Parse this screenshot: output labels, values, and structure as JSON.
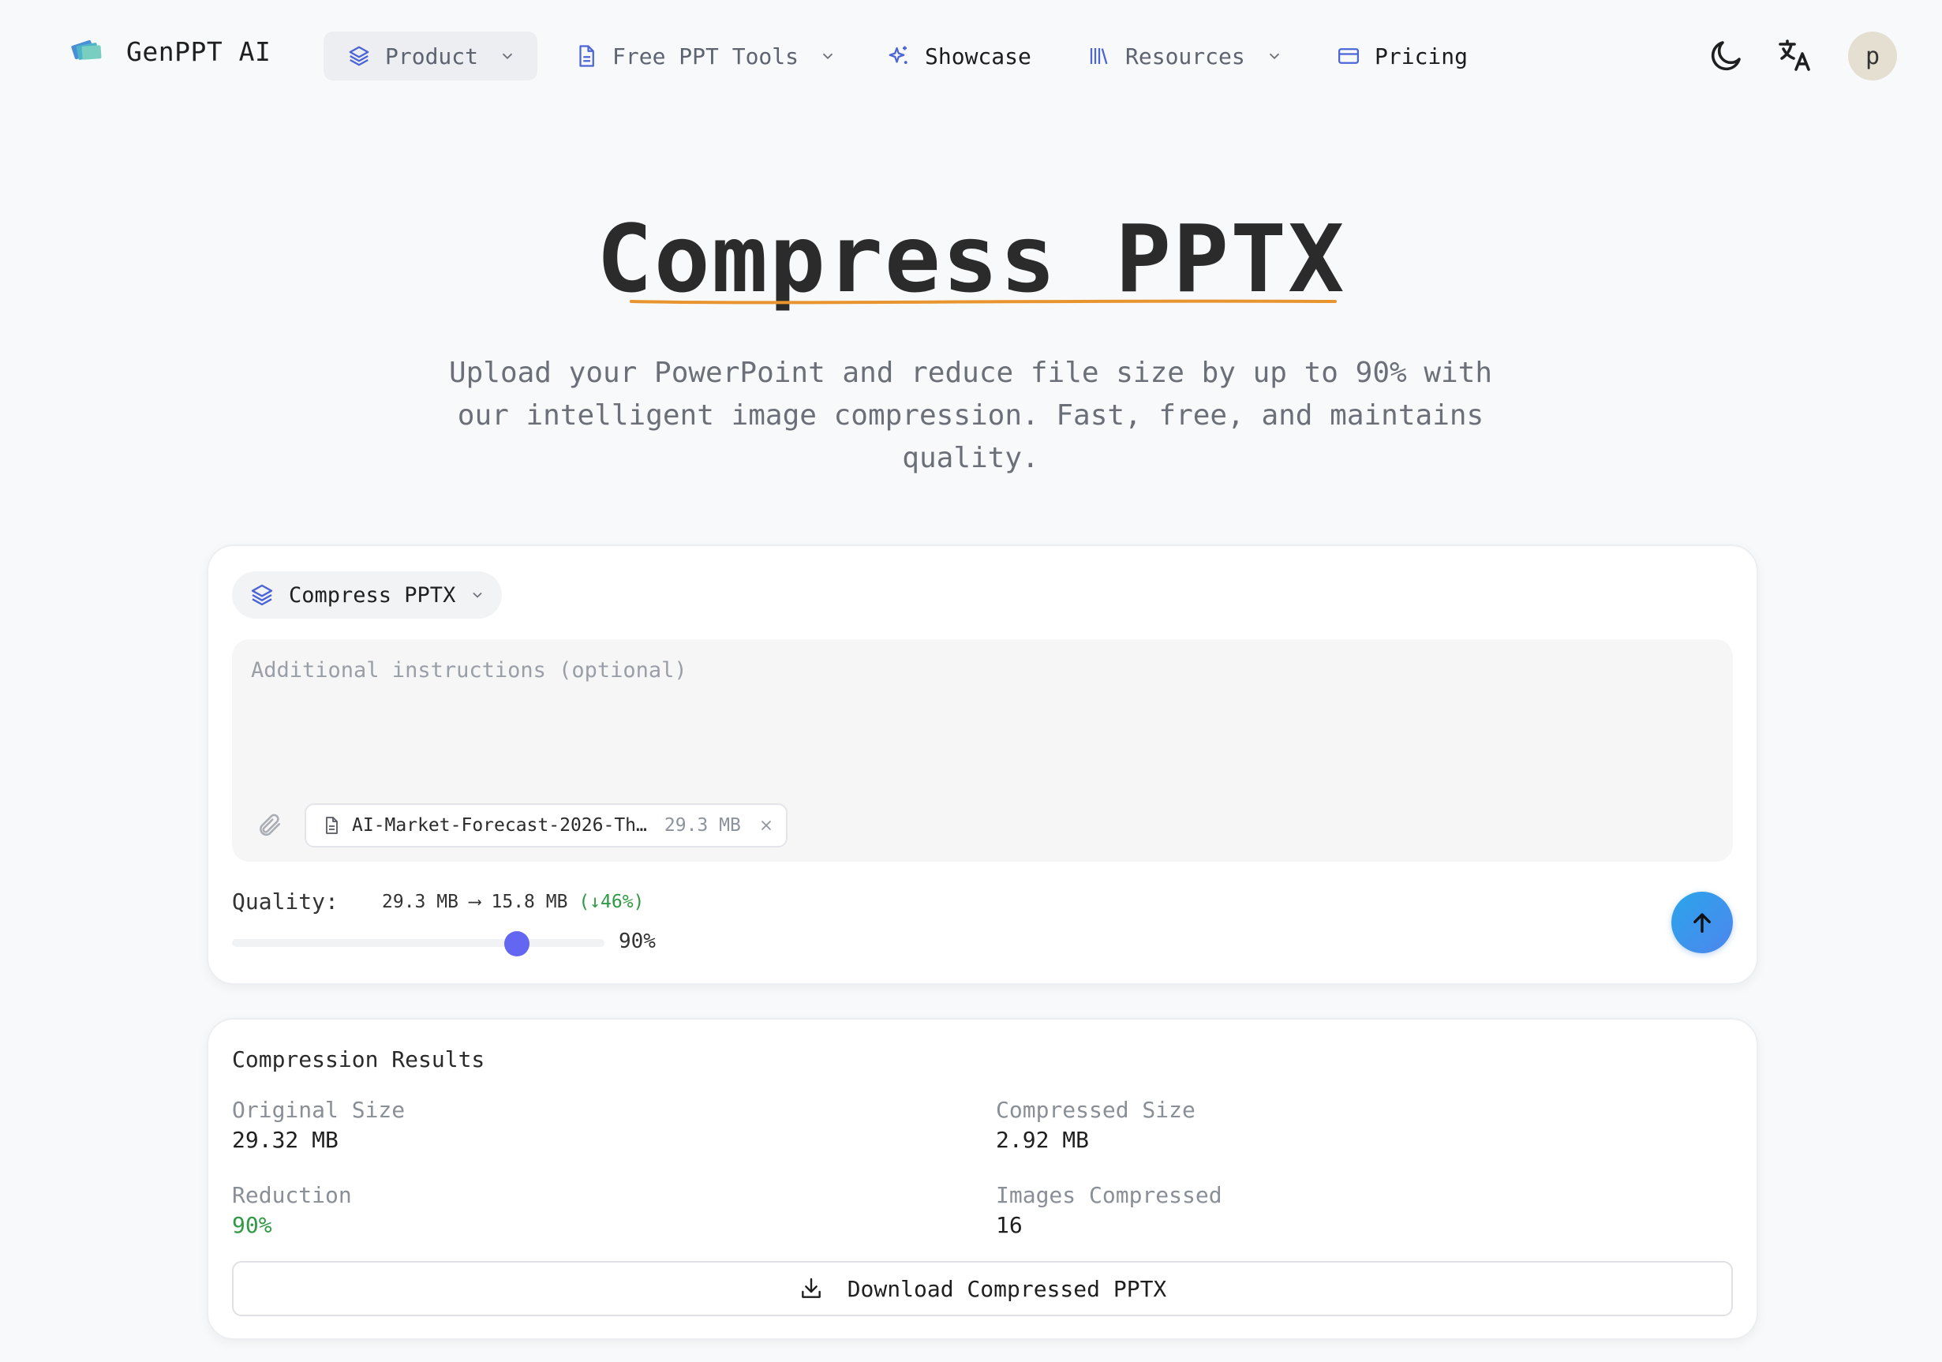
{
  "brand": {
    "name": "GenPPT AI",
    "logo_icon": "stack-cards-icon"
  },
  "nav": {
    "product": "Product",
    "free_tools": "Free PPT Tools",
    "showcase": "Showcase",
    "resources": "Resources",
    "pricing": "Pricing",
    "avatar_initial": "p"
  },
  "hero": {
    "title": "Compress PPTX",
    "subtitle": "Upload your PowerPoint and reduce file size by up to 90% with our intelligent image compression. Fast, free, and maintains quality."
  },
  "composer": {
    "mode": "Compress PPTX",
    "instructions_placeholder": "Additional instructions (optional)",
    "file": {
      "name": "AI-Market-Forecast-2026-Th…",
      "size": "29.3 MB"
    },
    "quality_label": "Quality:",
    "size_from": "29.3 MB",
    "arrow": "⟶",
    "size_to": "15.8 MB",
    "size_reduction": "(↓46%)",
    "quality_value": 0.9,
    "quality_display": "90%"
  },
  "results": {
    "title": "Compression Results",
    "original_label": "Original Size",
    "original_value": "29.32 MB",
    "compressed_label": "Compressed Size",
    "compressed_value": "2.92 MB",
    "reduction_label": "Reduction",
    "reduction_value": "90%",
    "images_label": "Images Compressed",
    "images_value": "16",
    "download_label": "Download Compressed PPTX"
  },
  "colors": {
    "accent": "#6366f1",
    "send_button": "#3b93ec",
    "success": "#2f9a43",
    "underline": "#e8952f"
  }
}
